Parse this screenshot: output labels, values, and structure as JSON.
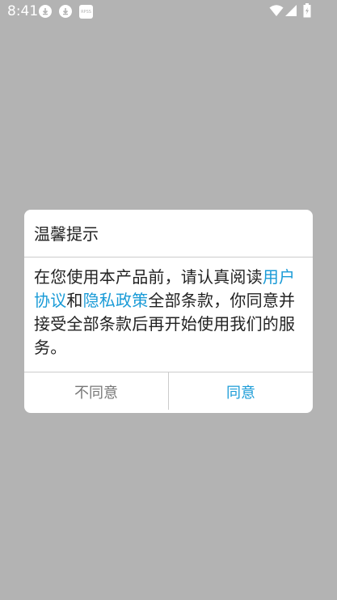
{
  "status_bar": {
    "time": "8:41",
    "notifications": [
      "download-icon",
      "download-icon",
      "app-notification-icon"
    ],
    "app_icon_text": "RPSS"
  },
  "dialog": {
    "title": "温馨提示",
    "body": {
      "part1": "在您使用本产品前，请认真阅读",
      "link_user_agreement": "用户协议",
      "part2": "和",
      "link_privacy_policy": "隐私政策",
      "part3": "全部条款，你同意并接受全部条款后再开始使用我们的服务。"
    },
    "buttons": {
      "disagree": "不同意",
      "agree": "同意"
    }
  },
  "colors": {
    "overlay": "#b3b3b3",
    "accent": "#1a9bd7",
    "text": "#222222",
    "secondary_text": "#777777"
  }
}
